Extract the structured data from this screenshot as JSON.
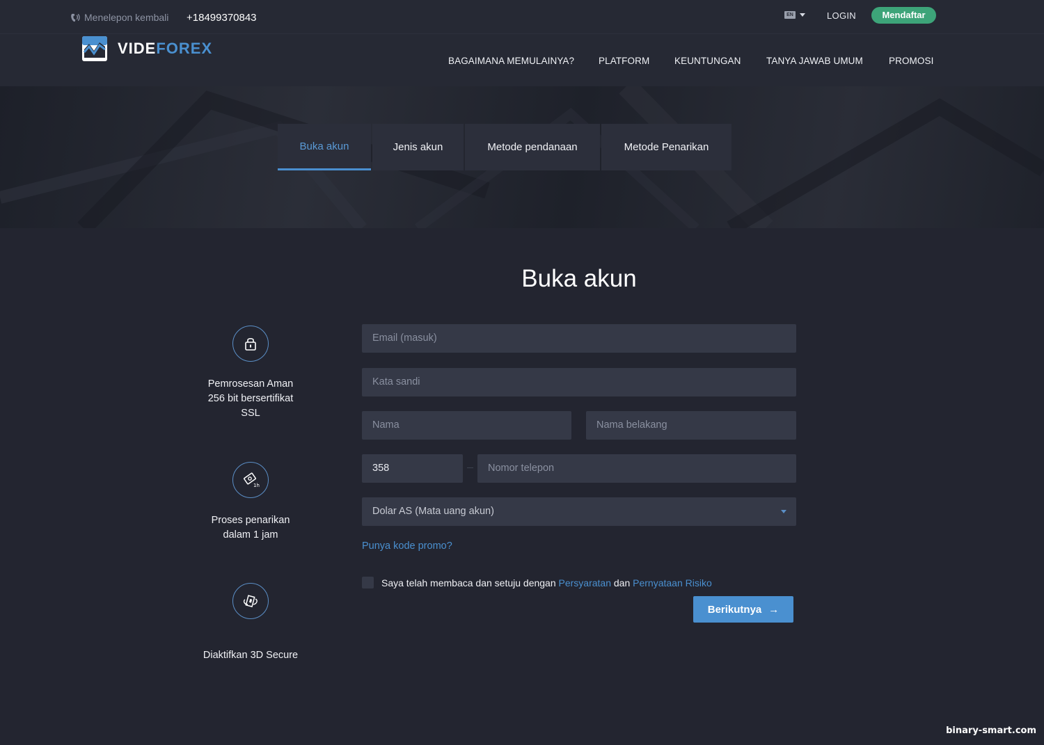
{
  "topbar": {
    "callback_label": "Menelepon kembali",
    "phone": "+18499370843",
    "lang_code": "EN",
    "login_label": "LOGIN",
    "signup_label": "Mendaftar"
  },
  "brand": {
    "name_part1": "VIDE",
    "name_part2": "FOREX",
    "accent_color": "#4a90d0",
    "signup_color": "#3da479"
  },
  "nav": {
    "items": [
      {
        "label": "BAGAIMANA MEMULAINYA?"
      },
      {
        "label": "PLATFORM"
      },
      {
        "label": "KEUNTUNGAN"
      },
      {
        "label": "TANYA JAWAB UMUM"
      },
      {
        "label": "PROMOSI"
      }
    ]
  },
  "tabs": [
    {
      "label": "Buka akun",
      "active": true
    },
    {
      "label": "Jenis akun",
      "active": false
    },
    {
      "label": "Metode pendanaan",
      "active": false
    },
    {
      "label": "Metode Penarikan",
      "active": false
    }
  ],
  "main": {
    "title": "Buka akun"
  },
  "features": [
    {
      "icon": "lock-icon",
      "lines": [
        "Pemrosesan Aman",
        "256 bit bersertifikat",
        "SSL"
      ]
    },
    {
      "icon": "withdraw-1h-icon",
      "lines": [
        "Proses penarikan",
        "dalam 1 jam"
      ]
    },
    {
      "icon": "3d-secure-icon",
      "lines": [
        "Diaktifkan 3D Secure"
      ]
    }
  ],
  "form": {
    "email_placeholder": "Email (masuk)",
    "password_placeholder": "Kata sandi",
    "first_name_placeholder": "Nama",
    "last_name_placeholder": "Nama belakang",
    "phone_code_value": "358",
    "phone_placeholder": "Nomor telepon",
    "currency_value": "Dolar AS (Mata uang akun)",
    "promo_link": "Punya kode promo?",
    "agree_text": "Saya telah membaca dan setuju dengan",
    "agree_link1": "Persyaratan",
    "agree_and": "dan",
    "agree_link2": "Pernyataan Risiko",
    "next_label": "Berikutnya",
    "next_arrow": "→"
  },
  "watermark": "binary-smart.com"
}
